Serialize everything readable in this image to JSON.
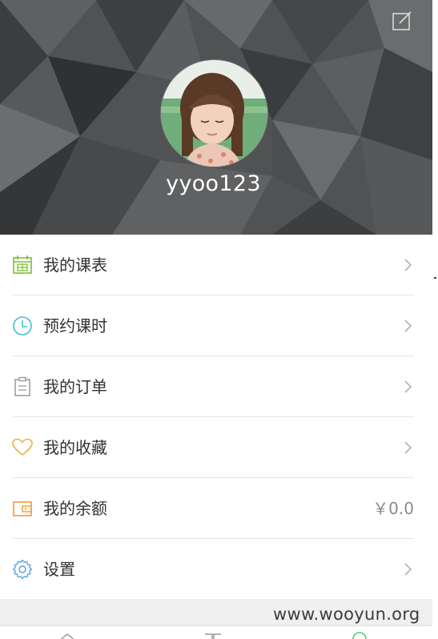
{
  "profile": {
    "username": "yyoo123"
  },
  "menu": {
    "items": [
      {
        "label": "我的课表",
        "icon": "calendar-icon",
        "color": "#7cbf2f"
      },
      {
        "label": "预约课时",
        "icon": "clock-icon",
        "color": "#3ec1c9"
      },
      {
        "label": "我的订单",
        "icon": "clipboard-icon",
        "color": "#9a9a9a"
      },
      {
        "label": "我的收藏",
        "icon": "heart-icon",
        "color": "#f0b33a"
      },
      {
        "label": "我的余额",
        "icon": "wallet-icon",
        "color": "#f29a3a",
        "value": "￥0.0"
      },
      {
        "label": "设置",
        "icon": "gear-icon",
        "color": "#5aa3d6"
      }
    ]
  },
  "watermark": "www.wooyun.org"
}
